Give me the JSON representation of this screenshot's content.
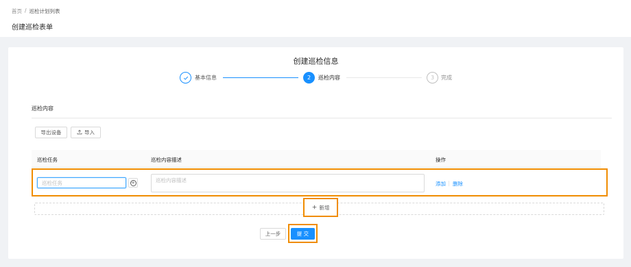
{
  "breadcrumb": {
    "home": "首页",
    "separator": "/",
    "current": "巡检计划列表"
  },
  "page_title": "创建巡检表单",
  "form_title": "创建巡检信息",
  "steps": [
    {
      "label": "基本信息",
      "status": "finished",
      "icon": "check-icon"
    },
    {
      "number": "2",
      "label": "巡检内容",
      "status": "process"
    },
    {
      "number": "3",
      "label": "完成",
      "status": "wait"
    }
  ],
  "section_title": "巡检内容",
  "toolbar": {
    "export_label": "导出设备",
    "import_label": "导入",
    "import_icon": "upload-icon"
  },
  "table": {
    "columns": [
      "巡检任务",
      "巡检内容描述",
      "操作"
    ],
    "rows": [
      {
        "task_placeholder": "巡检任务",
        "desc_placeholder": "巡检内容描述",
        "actions": [
          "添加",
          "删除"
        ]
      }
    ]
  },
  "add_row_label": "新增",
  "footer": {
    "prev_label": "上一步",
    "submit_label": "提 交"
  },
  "colors": {
    "primary": "#1890ff",
    "highlight": "#f08c00",
    "background": "#f0f2f5"
  }
}
